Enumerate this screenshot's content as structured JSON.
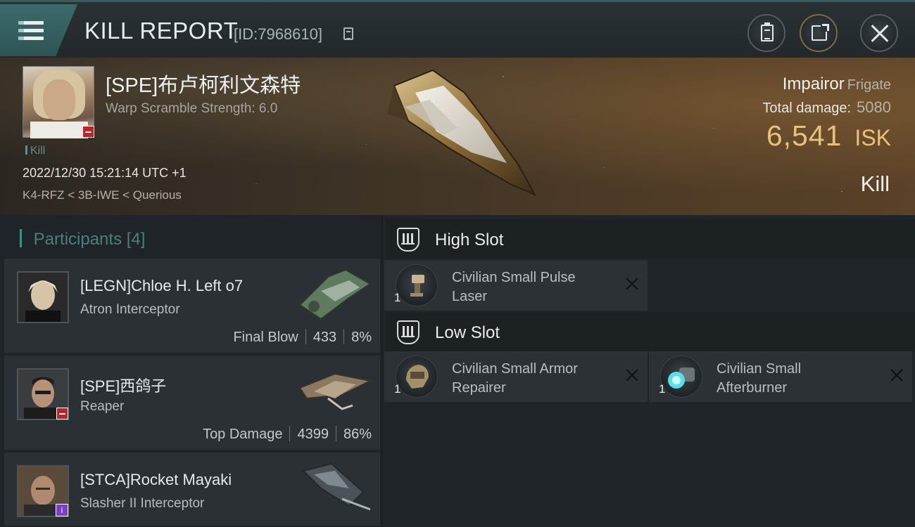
{
  "header": {
    "title": "KILL REPORT",
    "report_id": "[ID:7968610]"
  },
  "victim": {
    "name": "[SPE]布卢柯利文森特",
    "warp_scramble": "Warp Scramble Strength: 6.0",
    "tag": "Kill",
    "datetime": "2022/12/30 15:21:14 UTC +1",
    "location": "K4-RFZ < 3B-IWE < Querious",
    "ship_name": "Impairor",
    "ship_class": "Frigate",
    "total_damage_label": "Total damage:",
    "total_damage": "5080",
    "isk_value": "6,541",
    "isk_unit": "ISK",
    "result": "Kill"
  },
  "participants": {
    "label": "Participants",
    "count": "[4]",
    "rows": [
      {
        "name": "[LEGN]Chloe H. Left o7",
        "ship": "Atron Interceptor",
        "stat_label": "Final Blow",
        "damage": "433",
        "percent": "8%"
      },
      {
        "name": "[SPE]西鸽子",
        "ship": "Reaper",
        "stat_label": "Top Damage",
        "damage": "4399",
        "percent": "86%"
      },
      {
        "name": "[STCA]Rocket Mayaki",
        "ship": "Slasher II Interceptor"
      }
    ]
  },
  "fitting": {
    "high_slot": {
      "label": "High Slot",
      "modules": [
        {
          "name": "Civilian Small Pulse Laser",
          "qty": "1",
          "icon": "pulse-laser-icon"
        }
      ]
    },
    "low_slot": {
      "label": "Low Slot",
      "modules": [
        {
          "name": "Civilian Small Armor Repairer",
          "qty": "1",
          "icon": "armor-repairer-icon"
        },
        {
          "name": "Civilian Small Afterburner",
          "qty": "1",
          "icon": "afterburner-icon"
        }
      ]
    }
  },
  "colors": {
    "accent_teal": "#3f8f8a",
    "isk_gold": "#e8c277",
    "badge_red": "#c42126",
    "badge_purple": "#7b3fc9"
  },
  "icons": [
    "menu-icon",
    "copy-icon",
    "clipboard-icon",
    "share-icon",
    "close-icon",
    "slot-icon",
    "remove-icon"
  ]
}
